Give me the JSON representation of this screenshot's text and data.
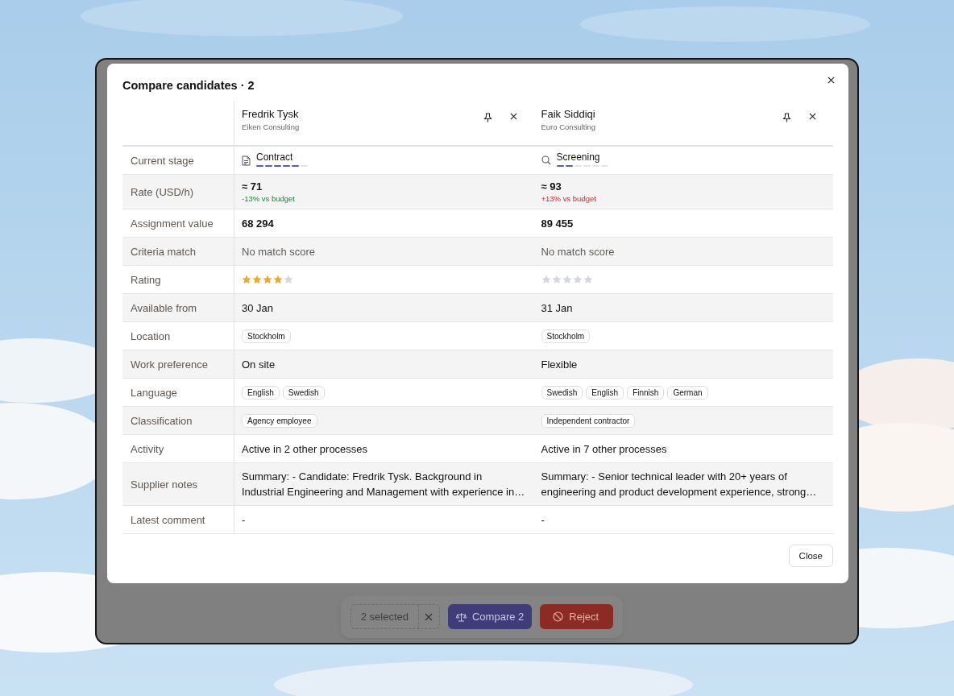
{
  "modal": {
    "title": "Compare candidates · 2",
    "footer_button": "Close"
  },
  "candidates": [
    {
      "name": "Fredrik Tysk",
      "company": "Eiken Consulting"
    },
    {
      "name": "Faik Siddiqi",
      "company": "Euro Consulting"
    }
  ],
  "rows": [
    {
      "label": "Current stage",
      "kind": "stage",
      "cells": [
        {
          "stage": "Contract",
          "kind": "contract",
          "level": 0.83
        },
        {
          "stage": "Screening",
          "kind": "screening",
          "level": 0.33
        }
      ]
    },
    {
      "label": "Rate (USD/h)",
      "kind": "rate",
      "cells": [
        {
          "value": "≈ 71",
          "note": "-13% vs budget",
          "over_budget": false
        },
        {
          "value": "≈ 93",
          "note": "+13% vs budget",
          "over_budget": true
        }
      ]
    },
    {
      "label": "Assignment value",
      "kind": "amount",
      "cells": [
        {
          "value": "68 294"
        },
        {
          "value": "89 455"
        }
      ]
    },
    {
      "label": "Criteria match",
      "kind": "muted",
      "cells": [
        {
          "value": "No match score"
        },
        {
          "value": "No match score"
        }
      ]
    },
    {
      "label": "Rating",
      "kind": "rating",
      "cells": [
        {
          "stars": 4
        },
        {
          "stars": 0
        }
      ]
    },
    {
      "label": "Available from",
      "kind": "text",
      "cells": [
        {
          "value": "30 Jan"
        },
        {
          "value": "31 Jan"
        }
      ]
    },
    {
      "label": "Location",
      "kind": "tags",
      "cells": [
        {
          "tags": [
            "Stockholm"
          ]
        },
        {
          "tags": [
            "Stockholm"
          ]
        }
      ]
    },
    {
      "label": "Work preference",
      "kind": "text",
      "cells": [
        {
          "value": "On site"
        },
        {
          "value": "Flexible"
        }
      ]
    },
    {
      "label": "Language",
      "kind": "tags",
      "cells": [
        {
          "tags": [
            "English",
            "Swedish"
          ]
        },
        {
          "tags": [
            "Swedish",
            "English",
            "Finnish",
            "German"
          ]
        }
      ]
    },
    {
      "label": "Classification",
      "kind": "tags",
      "cells": [
        {
          "tags": [
            "Agency employee"
          ]
        },
        {
          "tags": [
            "Independent contractor"
          ]
        }
      ]
    },
    {
      "label": "Activity",
      "kind": "text",
      "cells": [
        {
          "value": "Active in 2 other processes"
        },
        {
          "value": "Active in 7 other processes"
        }
      ]
    },
    {
      "label": "Supplier notes",
      "kind": "notes",
      "cells": [
        {
          "value": "Summary: - Candidate: Fredrik Tysk. Background in Industrial Engineering and Management with experience in…"
        },
        {
          "value": "Summary: - Senior technical leader with 20+ years of engineering and product development experience, strong…"
        }
      ]
    },
    {
      "label": "Latest comment",
      "kind": "text",
      "cells": [
        {
          "value": "-"
        },
        {
          "value": "-"
        }
      ]
    }
  ],
  "action_bar": {
    "selection": "2 selected",
    "compare_button": "Compare 2",
    "reject_button": "Reject"
  }
}
